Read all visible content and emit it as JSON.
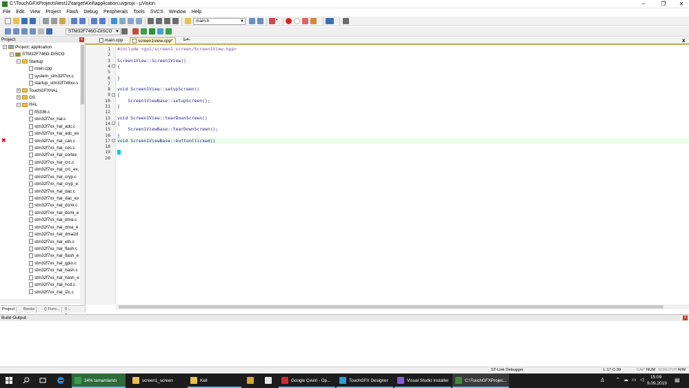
{
  "window": {
    "title": "C:\\TouchGFXProjects\\test12\\target\\Keil\\application.uvprojx - µVision",
    "min": "–",
    "max": "❐",
    "close": "✕"
  },
  "menu": [
    "File",
    "Edit",
    "View",
    "Project",
    "Flash",
    "Debug",
    "Peripherals",
    "Tools",
    "SVCS",
    "Window",
    "Help"
  ],
  "toolbar1": {
    "file_combo": "main.h"
  },
  "toolbar2": {
    "target_combo": "STM32F746G-DISCO"
  },
  "project": {
    "panel_title": "Project",
    "close": "x",
    "root": "Project: application",
    "target": "STM32F746G-DISCO",
    "groups": [
      {
        "label": "Startup",
        "expanded": true,
        "files": [
          "main.cpp",
          "system_stm32f7xx.c",
          "startup_stm32f746xx.s"
        ]
      },
      {
        "label": "TouchGFXHAL",
        "expanded": false,
        "files": []
      },
      {
        "label": "OS",
        "expanded": false,
        "files": []
      },
      {
        "label": "HAL",
        "expanded": true,
        "files": [
          "ft5336.c",
          "stm32f7xx_hal.c",
          "stm32f7xx_hal_adc.c",
          "stm32f7xx_hal_adc_ex",
          "stm32f7xx_hal_can.c",
          "stm32f7xx_hal_cec.c",
          "stm32f7xx_hal_cortex.",
          "stm32f7xx_hal_crc.c",
          "stm32f7xx_hal_crc_ex.",
          "stm32f7xx_hal_cryp.c",
          "stm32f7xx_hal_cryp_e:",
          "stm32f7xx_hal_dac.c",
          "stm32f7xx_hal_dac_ex",
          "stm32f7xx_hal_dcmi.c",
          "stm32f7xx_hal_dcmi_e",
          "stm32f7xx_hal_dma.c",
          "stm32f7xx_hal_dma_e",
          "stm32f7xx_hal_dma2d",
          "stm32f7xx_hal_eth.c",
          "stm32f7xx_hal_flash.c",
          "stm32f7xx_hal_flash_e",
          "stm32f7xx_hal_gpio.c",
          "stm32f7xx_hal_hash.c",
          "stm32f7xx_hal_hash_e",
          "stm32f7xx_hal_hcd.c",
          "stm32f7xx_hal_i2c.c"
        ]
      }
    ],
    "tabs": [
      "Project",
      "Books",
      "{} Func...",
      "0→ Temp..."
    ]
  },
  "editor": {
    "tabs": [
      {
        "label": "main.cpp",
        "active": false
      },
      {
        "label": "screen1view.cpp*",
        "active": true
      }
    ],
    "annotation": "L̶+̶",
    "close": "x",
    "lines": [
      {
        "n": "1",
        "text": "#include <gui/screen1_screen/Screen1View.hpp>"
      },
      {
        "n": "2",
        "text": ""
      },
      {
        "n": "3",
        "text": "Screen1View::Screen1View()"
      },
      {
        "n": "4",
        "text": "{"
      },
      {
        "n": "5",
        "text": ""
      },
      {
        "n": "6",
        "text": "}"
      },
      {
        "n": "7",
        "text": ""
      },
      {
        "n": "8",
        "text": "void Screen1View::setupScreen()"
      },
      {
        "n": "9",
        "text": "{"
      },
      {
        "n": "10",
        "text": "    Screen1ViewBase::setupScreen();"
      },
      {
        "n": "11",
        "text": "}"
      },
      {
        "n": "12",
        "text": ""
      },
      {
        "n": "13",
        "text": "void Screen1View::tearDownScreen()"
      },
      {
        "n": "14",
        "text": "{"
      },
      {
        "n": "15",
        "text": "    Screen1ViewBase::tearDownScreen();"
      },
      {
        "n": "16",
        "text": "}"
      },
      {
        "n": "17",
        "text": "void Screen1ViewBase::buttonClicked()"
      },
      {
        "n": "18",
        "text": ""
      },
      {
        "n": "19",
        "text": "}"
      },
      {
        "n": "20",
        "text": ""
      }
    ],
    "error_line": "17",
    "error_mark": "✖"
  },
  "build_output": {
    "title": "Build Output",
    "close": "x"
  },
  "status": {
    "debugger": "ST-Link Debugger",
    "position": "L:17 C:39",
    "cap": "CAP",
    "num": "NUM",
    "scrl": "SCRL",
    "ovr": "OVR",
    "rw": "R/W"
  },
  "taskbar": {
    "items": [
      {
        "label": "34%  tamamlandı",
        "icon_color": "#3a9d4a"
      },
      {
        "label": "screen1_screen",
        "icon_color": "#e8c04e"
      },
      {
        "label": "Keil",
        "icon_color": "#e8c04e"
      },
      {
        "label": "",
        "icon_color": "#d9a533"
      },
      {
        "label": "",
        "icon_color": "#e8e8e8"
      },
      {
        "label": "Google Çeviri - Op...",
        "icon_color": "#d22c2c"
      },
      {
        "label": "TouchGFX Designer",
        "icon_color": "#2f9ad6"
      },
      {
        "label": "Visual Studio Installer",
        "icon_color": "#8a5bd6"
      },
      {
        "label": "C:\\TouchGFXProjec...",
        "icon_color": "#3a8c3a"
      }
    ],
    "time": "15:09",
    "date": "9.09.2019"
  }
}
